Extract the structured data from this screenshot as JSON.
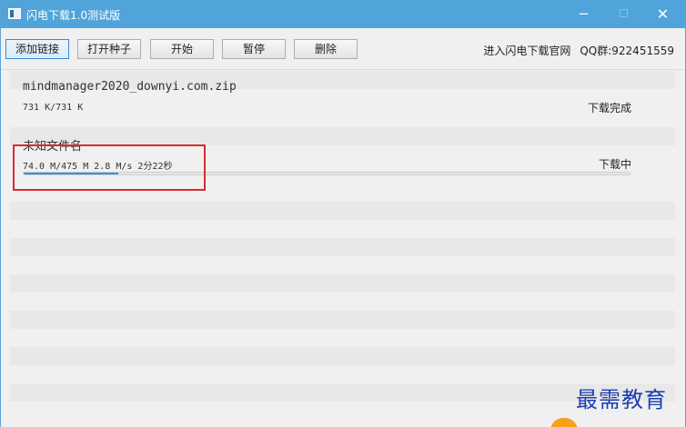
{
  "window": {
    "title": "闪电下载1.0测试版",
    "min": "−",
    "max": "☐",
    "close": "✕"
  },
  "toolbar": {
    "add_link": "添加链接",
    "open_torrent": "打开种子",
    "start": "开始",
    "pause": "暂停",
    "delete": "删除",
    "official_site": "进入闪电下载官网",
    "qq_group": "QQ群:922451559"
  },
  "downloads": [
    {
      "name": "mindmanager2020_downyi.com.zip",
      "info": "731 K/731 K",
      "status": "下载完成",
      "progress": 1.0
    },
    {
      "name": "未知文件名",
      "info": "74.0 M/475 M  2.8 M/s  2分22秒",
      "status": "下载中",
      "progress": 0.156
    }
  ],
  "watermark": "最需教育",
  "colors": {
    "titlebar": "#50a4da",
    "progress": "#3d8fd1",
    "highlight": "#d62d2d"
  }
}
